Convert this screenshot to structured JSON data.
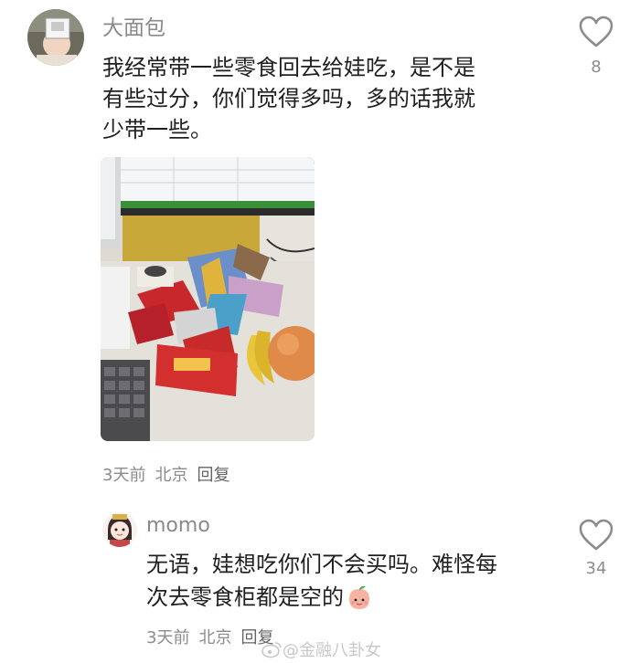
{
  "comments": [
    {
      "username": "大面包",
      "text_lines": [
        "我经常带一些零食回去给娃吃，是不是",
        "有些过分，你们觉得多吗，多的话我就",
        "少带一些。"
      ],
      "meta": {
        "time": "3天前",
        "location": "北京",
        "reply": "回复"
      },
      "likes": "8"
    },
    {
      "username": "momo",
      "text_lines": [
        "无语，娃想吃你们不会买吗。难怪每",
        "次去零食柜都是空的"
      ],
      "emoji": "peach-emoji",
      "meta": {
        "time": "3天前",
        "location": "北京",
        "reply": "回复"
      },
      "likes": "34"
    }
  ],
  "watermark": "@金融八卦女",
  "icons": {
    "like": "heart-icon",
    "watermark_logo": "weibo-icon"
  }
}
